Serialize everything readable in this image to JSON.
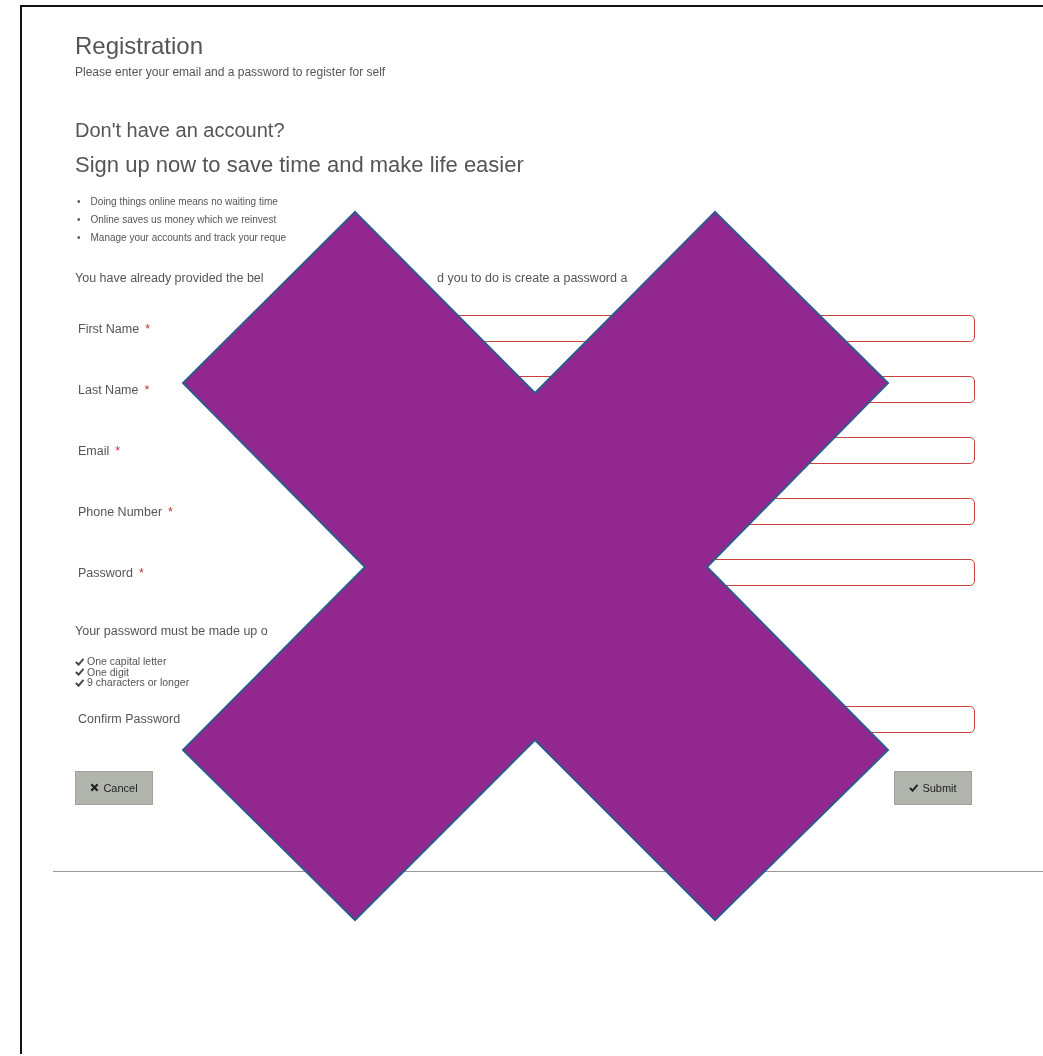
{
  "title": "Registration",
  "subtitle": "Please enter your email and a password to register for self",
  "headings": [
    "Don't have an account?",
    "Sign up now to save time and make life easier"
  ],
  "benefits": [
    {
      "bullet": "•",
      "text": "Doing things online means no waiting time"
    },
    {
      "bullet": "•",
      "text": "Online saves us money which we reinvest"
    },
    {
      "bullet": "•",
      "text": "Manage your accounts and track your reque"
    }
  ],
  "notice_fragments": [
    "You have already provided the bel",
    "d you to do is create a password a"
  ],
  "fields": [
    {
      "label": "First Name",
      "required_mark": "*"
    },
    {
      "label": "Last Name",
      "required_mark": "*"
    },
    {
      "label": "Email",
      "required_mark": "*"
    },
    {
      "label": "Phone Number",
      "required_mark": "*"
    },
    {
      "label": "Password",
      "required_mark": "*"
    }
  ],
  "password_rules_intro": "Your password must be made up o",
  "password_rules": [
    "One capital letter",
    "One digit",
    "9 characters or longer"
  ],
  "confirm_field": {
    "label": "Confirm Password"
  },
  "buttons": [
    {
      "kind": "cancel",
      "label": "Cancel"
    },
    {
      "kind": "submit",
      "label": "Submit"
    }
  ],
  "overlay": {
    "kind": "cross"
  }
}
